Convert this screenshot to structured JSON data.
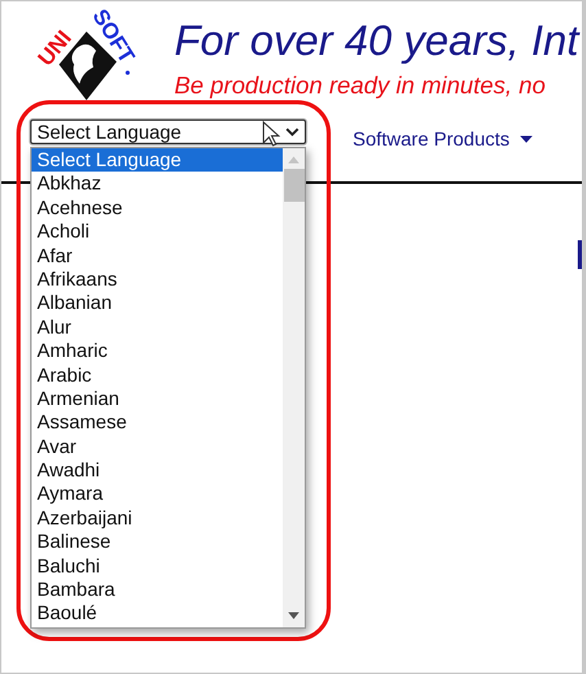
{
  "logo": {
    "left": "UNI",
    "right": "SOFT"
  },
  "header": {
    "title": "For over 40 years, Int",
    "subtitle": "Be production ready in minutes, no"
  },
  "language_select": {
    "value": "Select Language",
    "expanded": true,
    "options": [
      {
        "label": "Select Language",
        "selected": true
      },
      {
        "label": "Abkhaz",
        "selected": false
      },
      {
        "label": "Acehnese",
        "selected": false
      },
      {
        "label": "Acholi",
        "selected": false
      },
      {
        "label": "Afar",
        "selected": false
      },
      {
        "label": "Afrikaans",
        "selected": false
      },
      {
        "label": "Albanian",
        "selected": false
      },
      {
        "label": "Alur",
        "selected": false
      },
      {
        "label": "Amharic",
        "selected": false
      },
      {
        "label": "Arabic",
        "selected": false
      },
      {
        "label": "Armenian",
        "selected": false
      },
      {
        "label": "Assamese",
        "selected": false
      },
      {
        "label": "Avar",
        "selected": false
      },
      {
        "label": "Awadhi",
        "selected": false
      },
      {
        "label": "Aymara",
        "selected": false
      },
      {
        "label": "Azerbaijani",
        "selected": false
      },
      {
        "label": "Balinese",
        "selected": false
      },
      {
        "label": "Baluchi",
        "selected": false
      },
      {
        "label": "Bambara",
        "selected": false
      },
      {
        "label": "Baoulé",
        "selected": false
      }
    ]
  },
  "nav": [
    {
      "label": "Software Products"
    }
  ]
}
